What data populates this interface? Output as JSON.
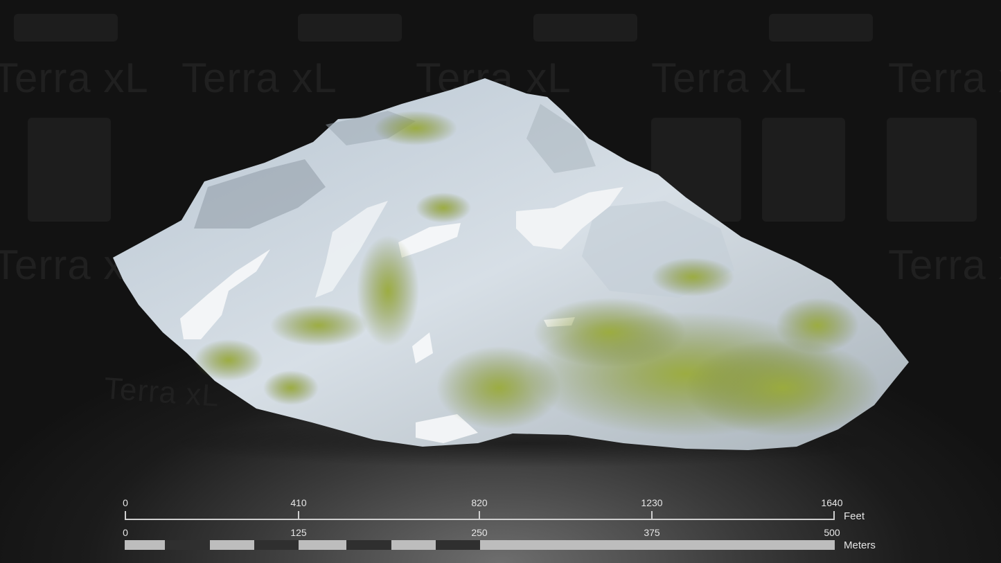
{
  "watermark": {
    "text": "Terra xL"
  },
  "scale_bar": {
    "feet": {
      "unit": "Feet",
      "ticks": [
        "0",
        "410",
        "820",
        "1230",
        "1640"
      ]
    },
    "meters": {
      "unit": "Meters",
      "ticks": [
        "0",
        "125",
        "250",
        "375",
        "500"
      ]
    },
    "colors": {
      "line": "#cfcfcf",
      "bar_light": "#bdbdbd",
      "bar_dark": "#2f2f2f",
      "text": "#e6e6e6"
    }
  },
  "terrain": {
    "icon": "mountain-model-icon",
    "colors": {
      "rock": "#c9d3dc",
      "snow": "#f2f4f6",
      "moss": "#8a9a2e",
      "shadow": "#6f7a85"
    }
  }
}
